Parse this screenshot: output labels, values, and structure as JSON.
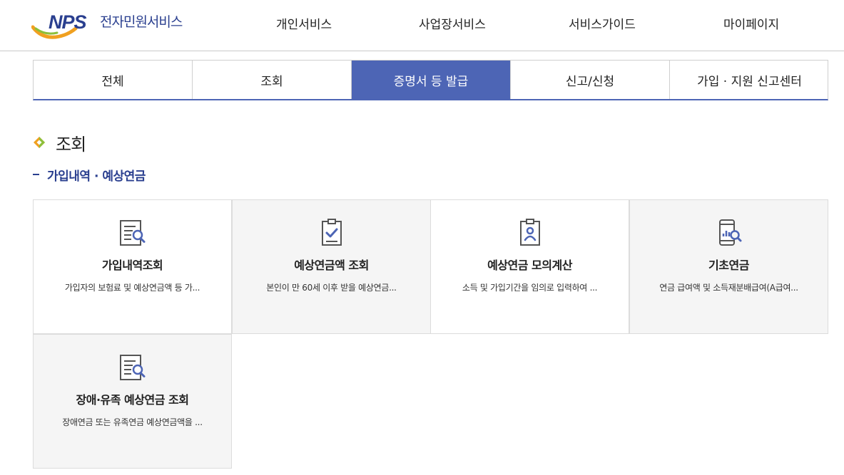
{
  "header": {
    "logo_text": "NPS",
    "site_title": "전자민원서비스",
    "nav": [
      "개인서비스",
      "사업장서비스",
      "서비스가이드",
      "마이페이지"
    ]
  },
  "tabs": [
    {
      "label": "전체",
      "active": false
    },
    {
      "label": "조회",
      "active": false
    },
    {
      "label": "증명서 등 발급",
      "active": true
    },
    {
      "label": "신고/신청",
      "active": false
    },
    {
      "label": "가입 · 지원 신고센터",
      "active": false
    }
  ],
  "section": {
    "title": "조회",
    "subtitle": "가입내역 · 예상연금"
  },
  "cards": [
    {
      "icon": "document-search-icon",
      "title": "가입내역조회",
      "desc": "가입자의 보험료 및 예상연금액 등 가..."
    },
    {
      "icon": "clipboard-check-icon",
      "title": "예상연금액 조회",
      "desc": "본인이 만 60세 이후 받을 예상연금..."
    },
    {
      "icon": "person-card-icon",
      "title": "예상연금 모의계산",
      "desc": "소득 및 가입기간을 임의로 입력하여 ..."
    },
    {
      "icon": "mobile-chart-search-icon",
      "title": "기초연금",
      "desc": "연금 급여액 및 소득재분배급여(A급여..."
    },
    {
      "icon": "document-search-icon",
      "title": "장애·유족 예상연금 조회",
      "desc": "장애연금 또는 유족연금 예상연금액을 ..."
    }
  ],
  "colors": {
    "primary": "#4d65b5",
    "logo_blue": "#2a3f8f",
    "accent_orange": "#f0a020",
    "accent_green": "#8dbf3a"
  }
}
